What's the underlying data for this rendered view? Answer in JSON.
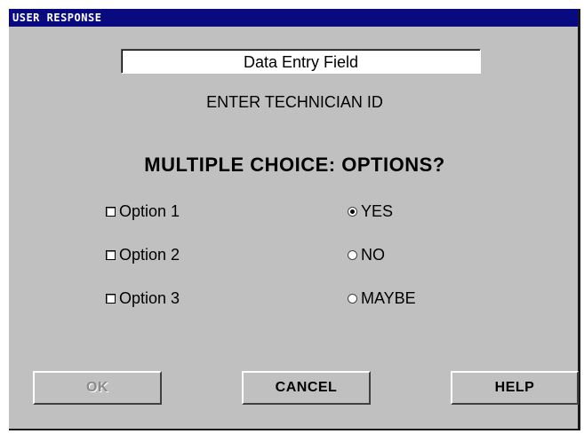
{
  "window": {
    "title": "USER RESPONSE"
  },
  "entry": {
    "value": "Data Entry Field"
  },
  "prompt": "ENTER TECHNICIAN ID",
  "question": "MULTIPLE CHOICE: OPTIONS?",
  "checkboxes": [
    {
      "label": "Option 1",
      "checked": false
    },
    {
      "label": "Option 2",
      "checked": false
    },
    {
      "label": "Option 3",
      "checked": false
    }
  ],
  "radios": [
    {
      "label": "YES",
      "selected": true
    },
    {
      "label": "NO",
      "selected": false
    },
    {
      "label": "MAYBE",
      "selected": false
    }
  ],
  "buttons": {
    "ok": {
      "label": "OK",
      "enabled": false
    },
    "cancel": {
      "label": "CANCEL",
      "enabled": true
    },
    "help": {
      "label": "HELP",
      "enabled": true
    }
  }
}
